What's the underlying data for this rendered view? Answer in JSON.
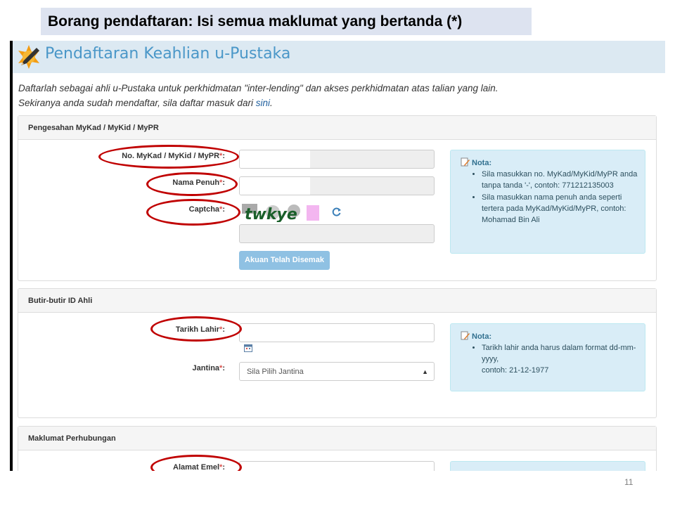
{
  "slide": {
    "title": "Borang pendaftaran: Isi semua maklumat yang bertanda (*)",
    "page_number": "11"
  },
  "site": {
    "header_title": "Pendaftaran Keahlian u-Pustaka",
    "intro_line1": "Daftarlah sebagai ahli u-Pustaka untuk perkhidmatan \"inter-lending\" dan akses perkhidmatan atas talian yang lain.",
    "intro_line2_prefix": "Sekiranya anda sudah mendaftar, sila daftar masuk dari ",
    "intro_link": "sini",
    "intro_line2_suffix": "."
  },
  "sections": {
    "verification": {
      "heading": "Pengesahan MyKad / MyKid / MyPR",
      "mykad_label": "No. MyKad / MyKid / MyPR",
      "name_label": "Nama Penuh",
      "captcha_label": "Captcha",
      "captcha_text": "twkye",
      "button_label": "Akuan Telah Disemak",
      "note_title": "Nota:",
      "note_items": [
        "Sila masukkan no. MyKad/MyKid/MyPR anda tanpa tanda '-', contoh: 771212135003",
        "Sila masukkan nama penuh anda seperti tertera pada MyKad/MyKid/MyPR, contoh: Mohamad Bin Ali"
      ]
    },
    "member_id": {
      "heading": "Butir-butir ID Ahli",
      "dob_label": "Tarikh Lahir",
      "gender_label": "Jantina",
      "gender_selected": "Sila Pilih Jantina",
      "note_title": "Nota:",
      "note_line1": "Tarikh lahir anda harus dalam format dd-mm-yyyy,",
      "note_line2": "contoh: 21-12-1977"
    },
    "contact": {
      "heading": "Maklumat Perhubungan",
      "email_label": "Alamat Emel"
    }
  },
  "common": {
    "required_mark": "*",
    "colon": ":"
  },
  "colors": {
    "header_bg": "#dce9f2",
    "header_title": "#4a97c8",
    "required": "#d9534f",
    "note_bg": "#d9edf7",
    "button_bg": "#8fc1e3",
    "annotation_oval": "#c00000",
    "slide_title_bg": "#dde3f0"
  },
  "icons": [
    "pencil-logo-icon",
    "note-pencil-icon",
    "refresh-icon",
    "calendar-icon",
    "select-caret-icon"
  ]
}
